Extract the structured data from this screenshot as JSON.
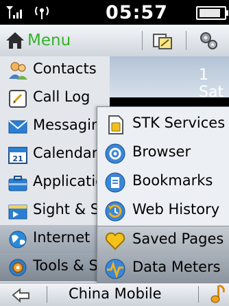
{
  "status_bar": {
    "time": "05:57",
    "battery_percent": 100,
    "icons": [
      "signal-icon",
      "antenna-icon",
      "battery-icon"
    ]
  },
  "toolbar": {
    "menu_label": "Menu",
    "icons": [
      "home-icon",
      "edit-icon",
      "settings-icon"
    ]
  },
  "background": {
    "date_text": "1 Sat"
  },
  "menu": {
    "items": [
      {
        "label": "Contacts",
        "icon": "contacts-icon"
      },
      {
        "label": "Call Log",
        "icon": "call-log-icon"
      },
      {
        "label": "Messaging",
        "icon": "message-icon"
      },
      {
        "label": "Calendar",
        "icon": "calendar-icon"
      },
      {
        "label": "Applications",
        "icon": "applications-icon"
      },
      {
        "label": "Sight & Sound",
        "icon": "media-icon"
      },
      {
        "label": "Internet",
        "icon": "globe-icon"
      },
      {
        "label": "Tools & Settings",
        "icon": "gear-icon"
      }
    ]
  },
  "submenu": {
    "items": [
      {
        "label": "STK Services",
        "icon": "sim-icon"
      },
      {
        "label": "Browser",
        "icon": "at-icon"
      },
      {
        "label": "Bookmarks",
        "icon": "bookmarks-icon"
      },
      {
        "label": "Web History",
        "icon": "history-icon"
      },
      {
        "label": "Saved Pages",
        "icon": "heart-icon"
      },
      {
        "label": "Data Meters",
        "icon": "data-meter-icon"
      }
    ]
  },
  "bottom_bar": {
    "operator": "China Mobile",
    "icons": [
      "back-icon",
      "music-icon"
    ]
  },
  "colors": {
    "menu_accent": "#34b12a",
    "menu_bg": "#e3e7ec",
    "highlight": "#9aa3ad"
  }
}
